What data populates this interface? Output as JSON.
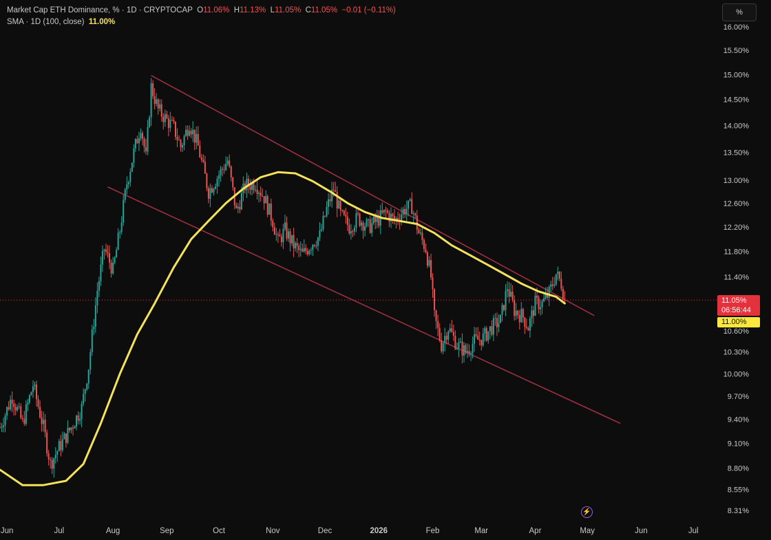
{
  "header": {
    "symbol": "Market Cap ETH Dominance, % · 1D · CRYPTOCAP",
    "o_label": "O",
    "o_value": "11.06%",
    "h_label": "H",
    "h_value": "11.13%",
    "l_label": "L",
    "l_value": "11.05%",
    "c_label": "C",
    "c_value": "11.05%",
    "change": "−0.01 (−0.11%)",
    "sma_label": "SMA · 1D (100, close)",
    "sma_value": "11.00%"
  },
  "unit_button": "%",
  "price_tag": {
    "price": "11.05%",
    "countdown": "06:56:44"
  },
  "sma_tag": "11.00%",
  "colors": {
    "background": "#0d0d0d",
    "up": "#26a69a",
    "down": "#ef5350",
    "sma": "#f4e35a",
    "channel": "#9c2f42",
    "axis_text": "#c9c9c9"
  },
  "icons": {
    "flash": "lightning-bolt-icon"
  },
  "chart_data": {
    "type": "candlestick",
    "title": "Market Cap ETH Dominance, %",
    "ylabel": "%",
    "y_scale": "log",
    "y_ticks": [
      "16.00%",
      "15.50%",
      "15.00%",
      "14.50%",
      "14.00%",
      "13.50%",
      "13.00%",
      "12.60%",
      "12.20%",
      "11.80%",
      "11.40%",
      "11.00%",
      "10.60%",
      "10.30%",
      "10.00%",
      "9.70%",
      "9.40%",
      "9.10%",
      "8.80%",
      "8.55%",
      "8.31%"
    ],
    "x_ticks": [
      "Jun",
      "Jul",
      "Aug",
      "Sep",
      "Oct",
      "Nov",
      "Dec",
      "2026",
      "Feb",
      "Mar",
      "Apr",
      "May",
      "Jun",
      "Jul"
    ],
    "x_tick_dates": [
      "2025-06-01",
      "2025-07-01",
      "2025-08-01",
      "2025-09-01",
      "2025-10-01",
      "2025-11-01",
      "2025-12-01",
      "2026-01-01",
      "2026-02-01",
      "2026-03-01",
      "2026-04-01",
      "2026-05-01",
      "2026-06-01",
      "2026-07-01"
    ],
    "x_range": [
      "2025-05-28",
      "2026-07-14"
    ],
    "ylim": [
      8.31,
      16.0
    ],
    "price_path": [
      [
        "2025-05-28",
        9.3
      ],
      [
        "2025-06-04",
        9.7
      ],
      [
        "2025-06-10",
        9.35
      ],
      [
        "2025-06-16",
        9.85
      ],
      [
        "2025-06-22",
        9.3
      ],
      [
        "2025-06-26",
        8.85
      ],
      [
        "2025-07-01",
        9.05
      ],
      [
        "2025-07-08",
        9.3
      ],
      [
        "2025-07-14",
        9.55
      ],
      [
        "2025-07-18",
        10.1
      ],
      [
        "2025-07-23",
        11.2
      ],
      [
        "2025-07-27",
        11.85
      ],
      [
        "2025-08-01",
        11.5
      ],
      [
        "2025-08-05",
        12.15
      ],
      [
        "2025-08-09",
        12.95
      ],
      [
        "2025-08-13",
        13.5
      ],
      [
        "2025-08-17",
        14.0
      ],
      [
        "2025-08-20",
        13.4
      ],
      [
        "2025-08-23",
        14.75
      ],
      [
        "2025-08-27",
        14.3
      ],
      [
        "2025-09-01",
        14.1
      ],
      [
        "2025-09-05",
        13.95
      ],
      [
        "2025-09-09",
        13.6
      ],
      [
        "2025-09-14",
        14.05
      ],
      [
        "2025-09-19",
        13.6
      ],
      [
        "2025-09-25",
        12.8
      ],
      [
        "2025-09-30",
        13.05
      ],
      [
        "2025-10-06",
        13.35
      ],
      [
        "2025-10-11",
        12.45
      ],
      [
        "2025-10-16",
        12.9
      ],
      [
        "2025-10-22",
        12.95
      ],
      [
        "2025-10-27",
        12.7
      ],
      [
        "2025-11-01",
        12.3
      ],
      [
        "2025-11-04",
        11.95
      ],
      [
        "2025-11-08",
        12.15
      ],
      [
        "2025-11-13",
        11.9
      ],
      [
        "2025-11-18",
        11.75
      ],
      [
        "2025-11-24",
        11.95
      ],
      [
        "2025-11-28",
        12.05
      ],
      [
        "2025-12-02",
        12.5
      ],
      [
        "2025-12-06",
        12.85
      ],
      [
        "2025-12-10",
        12.4
      ],
      [
        "2025-12-15",
        12.2
      ],
      [
        "2025-12-20",
        12.35
      ],
      [
        "2025-12-26",
        12.2
      ],
      [
        "2025-12-31",
        12.3
      ],
      [
        "2026-01-05",
        12.45
      ],
      [
        "2026-01-10",
        12.3
      ],
      [
        "2026-01-16",
        12.5
      ],
      [
        "2026-01-20",
        12.55
      ],
      [
        "2026-01-24",
        12.1
      ],
      [
        "2026-01-28",
        11.85
      ],
      [
        "2026-01-31",
        11.4
      ],
      [
        "2026-02-02",
        10.8
      ],
      [
        "2026-02-06",
        10.4
      ],
      [
        "2026-02-10",
        10.65
      ],
      [
        "2026-02-15",
        10.4
      ],
      [
        "2026-02-20",
        10.3
      ],
      [
        "2026-02-25",
        10.45
      ],
      [
        "2026-03-02",
        10.5
      ],
      [
        "2026-03-07",
        10.65
      ],
      [
        "2026-03-12",
        10.75
      ],
      [
        "2026-03-16",
        11.25
      ],
      [
        "2026-03-20",
        10.9
      ],
      [
        "2026-03-25",
        10.8
      ],
      [
        "2026-03-28",
        10.65
      ],
      [
        "2026-04-01",
        11.0
      ],
      [
        "2026-04-05",
        11.0
      ],
      [
        "2026-04-09",
        11.15
      ],
      [
        "2026-04-13",
        11.45
      ],
      [
        "2026-04-16",
        11.3
      ],
      [
        "2026-04-18",
        11.05
      ]
    ],
    "series": [
      {
        "name": "SMA (100, close)",
        "points": [
          [
            "2025-05-28",
            8.78
          ],
          [
            "2025-06-10",
            8.6
          ],
          [
            "2025-06-22",
            8.6
          ],
          [
            "2025-07-05",
            8.65
          ],
          [
            "2025-07-15",
            8.85
          ],
          [
            "2025-07-25",
            9.35
          ],
          [
            "2025-08-05",
            10.0
          ],
          [
            "2025-08-15",
            10.55
          ],
          [
            "2025-08-25",
            11.0
          ],
          [
            "2025-09-05",
            11.55
          ],
          [
            "2025-09-15",
            12.0
          ],
          [
            "2025-09-25",
            12.3
          ],
          [
            "2025-10-05",
            12.6
          ],
          [
            "2025-10-15",
            12.85
          ],
          [
            "2025-10-25",
            13.05
          ],
          [
            "2025-11-04",
            13.14
          ],
          [
            "2025-11-14",
            13.12
          ],
          [
            "2025-11-24",
            12.98
          ],
          [
            "2025-12-04",
            12.8
          ],
          [
            "2025-12-14",
            12.6
          ],
          [
            "2025-12-24",
            12.45
          ],
          [
            "2026-01-03",
            12.35
          ],
          [
            "2026-01-13",
            12.3
          ],
          [
            "2026-01-23",
            12.25
          ],
          [
            "2026-02-02",
            12.1
          ],
          [
            "2026-02-12",
            11.9
          ],
          [
            "2026-02-22",
            11.75
          ],
          [
            "2026-03-04",
            11.6
          ],
          [
            "2026-03-14",
            11.45
          ],
          [
            "2026-03-24",
            11.3
          ],
          [
            "2026-04-03",
            11.18
          ],
          [
            "2026-04-13",
            11.1
          ],
          [
            "2026-04-18",
            11.0
          ]
        ]
      }
    ],
    "channel": {
      "upper": [
        [
          "2025-08-23",
          14.98
        ],
        [
          "2026-05-05",
          10.82
        ]
      ],
      "lower": [
        [
          "2025-07-29",
          12.88
        ],
        [
          "2026-05-20",
          9.35
        ]
      ]
    },
    "current_price": 11.05
  }
}
